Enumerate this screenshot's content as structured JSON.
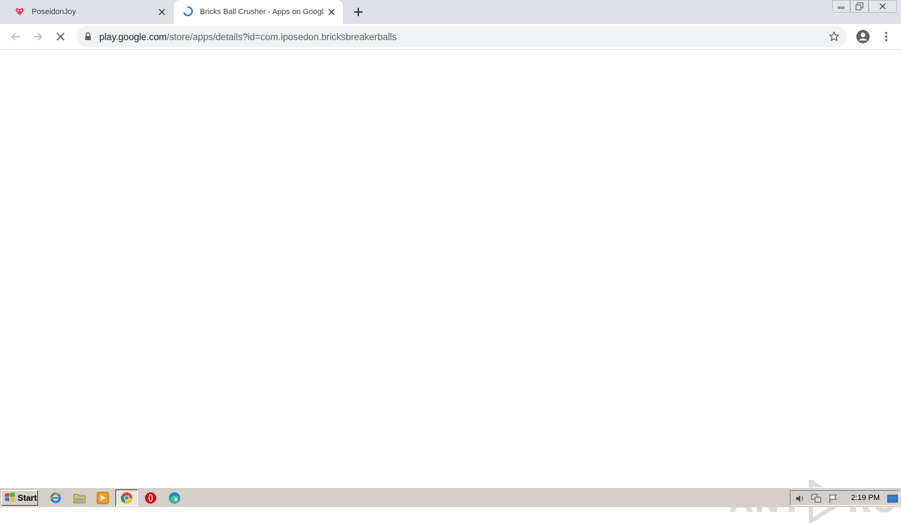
{
  "browser": {
    "tabs": [
      {
        "title": "PoseidonJoy",
        "active": false,
        "favicon": "poseidonjoy-favicon"
      },
      {
        "title": "Bricks Ball Crusher - Apps on Google Play",
        "active": true,
        "favicon": "loading-spinner"
      }
    ],
    "address_bar": {
      "host": "play.google.com",
      "path": "/store/apps/details?id=com.iposedon.bricksbreakerballs",
      "secure": true
    },
    "page_loading": true
  },
  "watermark": {
    "text_left": "ANY",
    "text_right": "RUN"
  },
  "taskbar": {
    "start_label": "Start",
    "pinned_icons": [
      "internet-explorer-icon",
      "file-explorer-icon",
      "media-player-icon",
      "chrome-icon",
      "opera-icon",
      "edge-icon"
    ],
    "active_app": "chrome-icon",
    "clock": "2:19 PM"
  },
  "colors": {
    "tabstrip": "#dee1e6",
    "accent": "#1a73e8",
    "taskbar": "#d4d0c8"
  }
}
